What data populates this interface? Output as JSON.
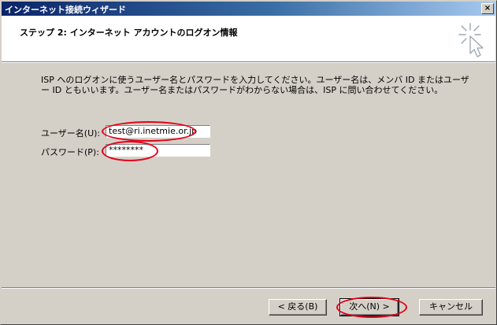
{
  "window": {
    "title": "インターネット接続ウィザード",
    "close_glyph": "×"
  },
  "header": {
    "heading": "ステップ 2: インターネット アカウントのログオン情報"
  },
  "description": {
    "line1": "ISP へのログオンに使うユーザー名とパスワードを入力してください。ユーザー名は、メンバ ID またはユーザ",
    "line2": "ー ID ともいいます。ユーザー名またはパスワードがわからない場合は、ISP に問い合わせてください。"
  },
  "form": {
    "username_label": "ユーザー名(U):",
    "username_value": "test@ri.inetmie.or.jp",
    "password_label": "パスワード(P):",
    "password_value": "********"
  },
  "buttons": {
    "back": "< 戻る(B)",
    "next": "次へ(N) >",
    "cancel": "キャンセル"
  },
  "colors": {
    "highlight_ellipse": "#e3001b",
    "dialog_face": "#d4d0c8"
  }
}
